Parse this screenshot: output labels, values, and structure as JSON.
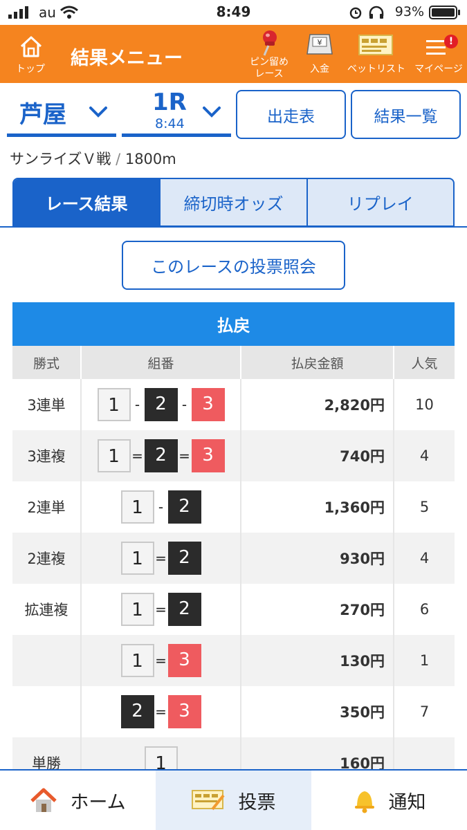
{
  "status_bar": {
    "carrier": "au",
    "time": "8:49",
    "battery": "93%"
  },
  "header": {
    "home_label": "トップ",
    "title": "結果メニュー",
    "pin_label_line1": "ピン留め",
    "pin_label_line2": "レース",
    "deposit_label": "入金",
    "betlist_label": "ベットリスト",
    "mypage_label": "マイページ",
    "mypage_badge": "!"
  },
  "selector": {
    "venue": "芦屋",
    "race": "1R",
    "race_time": "8:44",
    "entries_button": "出走表",
    "results_button": "結果一覧"
  },
  "race_info": {
    "name": "サンライズＶ戦",
    "slash": "/",
    "distance": "1800m"
  },
  "tabs": [
    {
      "label": "レース結果",
      "active": true
    },
    {
      "label": "締切時オッズ",
      "active": false
    },
    {
      "label": "リプレイ",
      "active": false
    }
  ],
  "vote_inquiry_button": "このレースの投票照会",
  "payout": {
    "title": "払戻",
    "columns": [
      "勝式",
      "組番",
      "払戻金額",
      "人気"
    ],
    "rows": [
      {
        "type": "3連単",
        "combo": [
          "1",
          "-",
          "2",
          "-",
          "3"
        ],
        "amount": "2,820円",
        "popularity": "10"
      },
      {
        "type": "3連複",
        "combo": [
          "1",
          "=",
          "2",
          "=",
          "3"
        ],
        "amount": "740円",
        "popularity": "4"
      },
      {
        "type": "2連単",
        "combo": [
          "1",
          "-",
          "2"
        ],
        "amount": "1,360円",
        "popularity": "5"
      },
      {
        "type": "2連複",
        "combo": [
          "1",
          "=",
          "2"
        ],
        "amount": "930円",
        "popularity": "4"
      },
      {
        "type": "拡連複",
        "combo": [
          "1",
          "=",
          "2"
        ],
        "amount": "270円",
        "popularity": "6"
      },
      {
        "type": "",
        "combo": [
          "1",
          "=",
          "3"
        ],
        "amount": "130円",
        "popularity": "1"
      },
      {
        "type": "",
        "combo": [
          "2",
          "=",
          "3"
        ],
        "amount": "350円",
        "popularity": "7"
      },
      {
        "type": "単勝",
        "combo": [
          "1"
        ],
        "amount": "160円",
        "popularity": ""
      }
    ]
  },
  "bottom_nav": {
    "home": "ホーム",
    "vote": "投票",
    "notify": "通知"
  },
  "colors": {
    "orange": "#f5841f",
    "blue": "#1a63c9",
    "boat1": "#f4f4f4",
    "boat2": "#2b2b2b",
    "boat3": "#ef5b5f"
  }
}
